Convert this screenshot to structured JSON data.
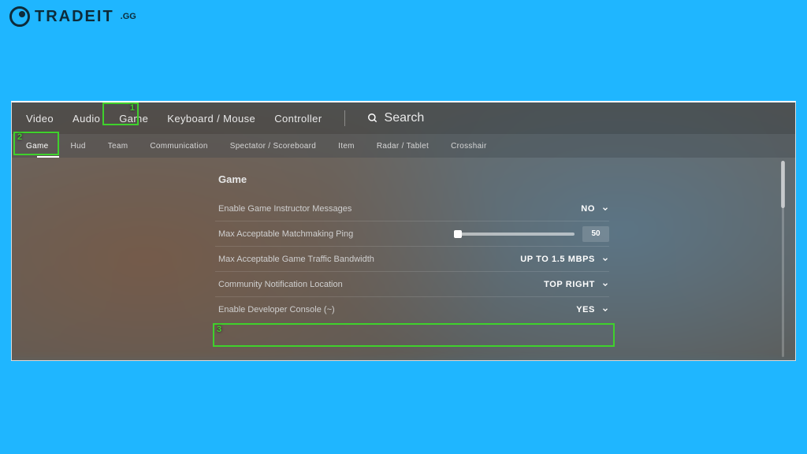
{
  "brand": {
    "name": "TRADEIT",
    "suffix": ".GG"
  },
  "top_tabs": {
    "video": "Video",
    "audio": "Audio",
    "game": "Game",
    "keyboard": "Keyboard / Mouse",
    "controller": "Controller",
    "search_label": "Search"
  },
  "sub_tabs": {
    "game": "Game",
    "hud": "Hud",
    "team": "Team",
    "communication": "Communication",
    "spectator": "Spectator / Scoreboard",
    "item": "Item",
    "radar": "Radar / Tablet",
    "crosshair": "Crosshair"
  },
  "section": {
    "title": "Game"
  },
  "rows": {
    "instructor": {
      "label": "Enable Game Instructor Messages",
      "value": "NO"
    },
    "ping": {
      "label": "Max Acceptable Matchmaking Ping",
      "value": "50"
    },
    "bandwidth": {
      "label": "Max Acceptable Game Traffic Bandwidth",
      "value": "UP TO 1.5 MBPS"
    },
    "notify": {
      "label": "Community Notification Location",
      "value": "TOP RIGHT"
    },
    "devconsole": {
      "label": "Enable Developer Console (~)",
      "value": "YES"
    }
  },
  "annotations": {
    "n1": "1",
    "n2": "2",
    "n3": "3"
  }
}
